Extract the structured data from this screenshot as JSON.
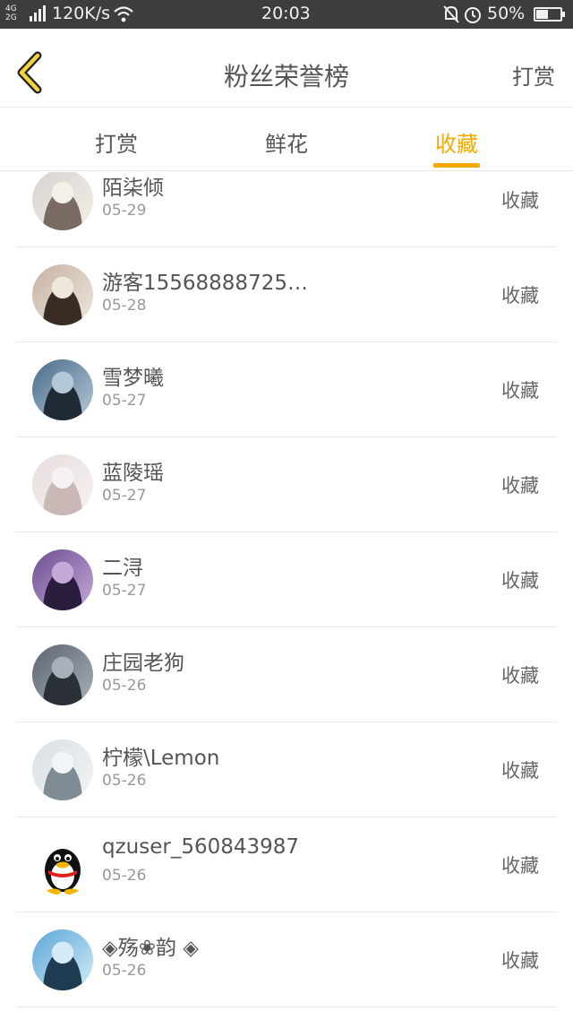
{
  "status_bar": {
    "network": [
      "4G",
      "2G"
    ],
    "speed": "120K/s",
    "time": "20:03",
    "battery": "50%",
    "battery_level": 0.5
  },
  "header": {
    "title": "粉丝荣誉榜",
    "action": "打赏"
  },
  "tabs": [
    {
      "label": "打赏",
      "active": false
    },
    {
      "label": "鲜花",
      "active": false
    },
    {
      "label": "收藏",
      "active": true
    }
  ],
  "colors": {
    "accent": "#f5a800",
    "statusbar": "#3d3d3d"
  },
  "rows": [
    {
      "name": "陌柒倾",
      "date": "05-29",
      "action": "收藏",
      "avatar": "photo-avatar"
    },
    {
      "name": "游客15568888725…",
      "date": "05-28",
      "action": "收藏",
      "avatar": "photo-avatar"
    },
    {
      "name": "雪梦曦",
      "date": "05-27",
      "action": "收藏",
      "avatar": "photo-avatar"
    },
    {
      "name": "蓝陵瑶",
      "date": "05-27",
      "action": "收藏",
      "avatar": "photo-avatar"
    },
    {
      "name": "二浔",
      "date": "05-27",
      "action": "收藏",
      "avatar": "photo-avatar"
    },
    {
      "name": "庄园老狗",
      "date": "05-26",
      "action": "收藏",
      "avatar": "photo-avatar"
    },
    {
      "name": "柠檬\\Lemon",
      "date": "05-26",
      "action": "收藏",
      "avatar": "photo-avatar"
    },
    {
      "name": "qzuser_560843987",
      "date": "05-26",
      "action": "收藏",
      "avatar": "penguin-avatar"
    },
    {
      "name": "◈殇❀韵 ◈",
      "date": "05-26",
      "action": "收藏",
      "avatar": "photo-avatar"
    }
  ]
}
